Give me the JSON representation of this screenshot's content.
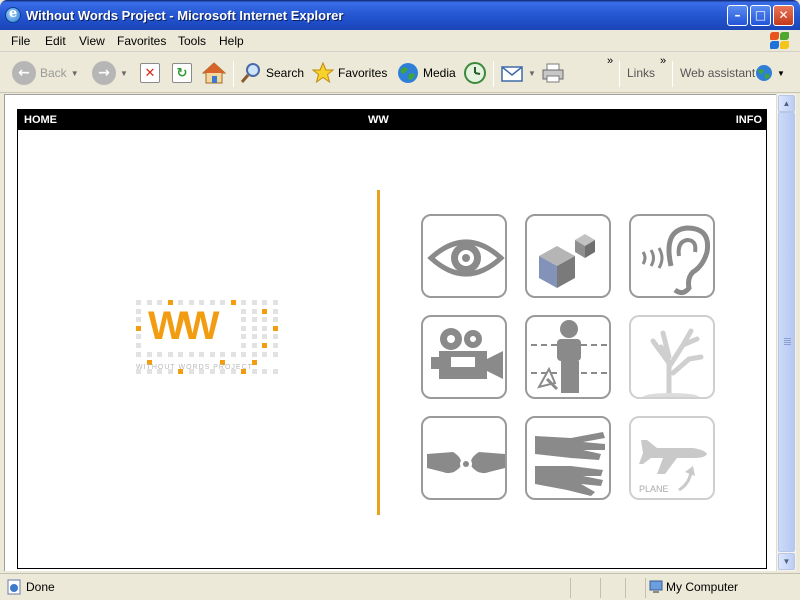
{
  "window": {
    "title": "Without Words Project - Microsoft Internet Explorer",
    "min": "–",
    "max": "□",
    "close": "✕"
  },
  "menu": [
    "File",
    "Edit",
    "View",
    "Favorites",
    "Tools",
    "Help"
  ],
  "toolbar": {
    "back": "Back",
    "search": "Search",
    "favorites": "Favorites",
    "media": "Media",
    "links": "Links",
    "web_assistant": "Web assistant",
    "chevron": "»"
  },
  "site": {
    "nav": {
      "home": "HOME",
      "center": "WW",
      "info": "INFO"
    },
    "logo": {
      "letters": "WW",
      "caption": "WITHOUT WORDS PROJECT"
    },
    "plane_label": "PLANE",
    "accent_color": "#e8a21c",
    "tiles": [
      "eye-icon",
      "cubes-icon",
      "ear-icon",
      "camera-icon",
      "person-cursor-icon",
      "tree-icon",
      "hands-icon",
      "gloves-icon",
      "plane-icon"
    ]
  },
  "status": {
    "text": "Done",
    "zone": "My Computer"
  }
}
